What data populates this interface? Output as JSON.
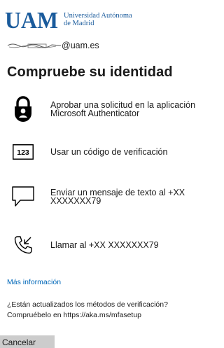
{
  "brand": {
    "logo_text": "UAM",
    "name_line1": "Universidad Autónoma",
    "name_line2": "de Madrid",
    "color": "#1a5b9c"
  },
  "account": {
    "domain": "@uam.es"
  },
  "title": "Compruebe su identidad",
  "options": [
    {
      "icon": "lock-icon",
      "line1": "Aprobar una solicitud en la aplicación",
      "line2": "Microsoft Authenticator"
    },
    {
      "icon": "keypad-code-icon",
      "icon_text": "123",
      "line1": "Usar un código de verificación"
    },
    {
      "icon": "message-icon",
      "line1": "Enviar un mensaje de texto al +XX",
      "line2": "XXXXXXX79"
    },
    {
      "icon": "phone-call-icon",
      "line1": "Llamar al +XX XXXXXXX79"
    }
  ],
  "more_info": "Más información",
  "update_question": "¿Están actualizados los métodos de verificación?",
  "update_link_text": "Compruébelo en https://aka.ms/mfasetup",
  "cancel_label": "Cancelar",
  "colors": {
    "link": "#0067b8",
    "button_bg": "#cccccc",
    "text": "#1b1b1b"
  }
}
